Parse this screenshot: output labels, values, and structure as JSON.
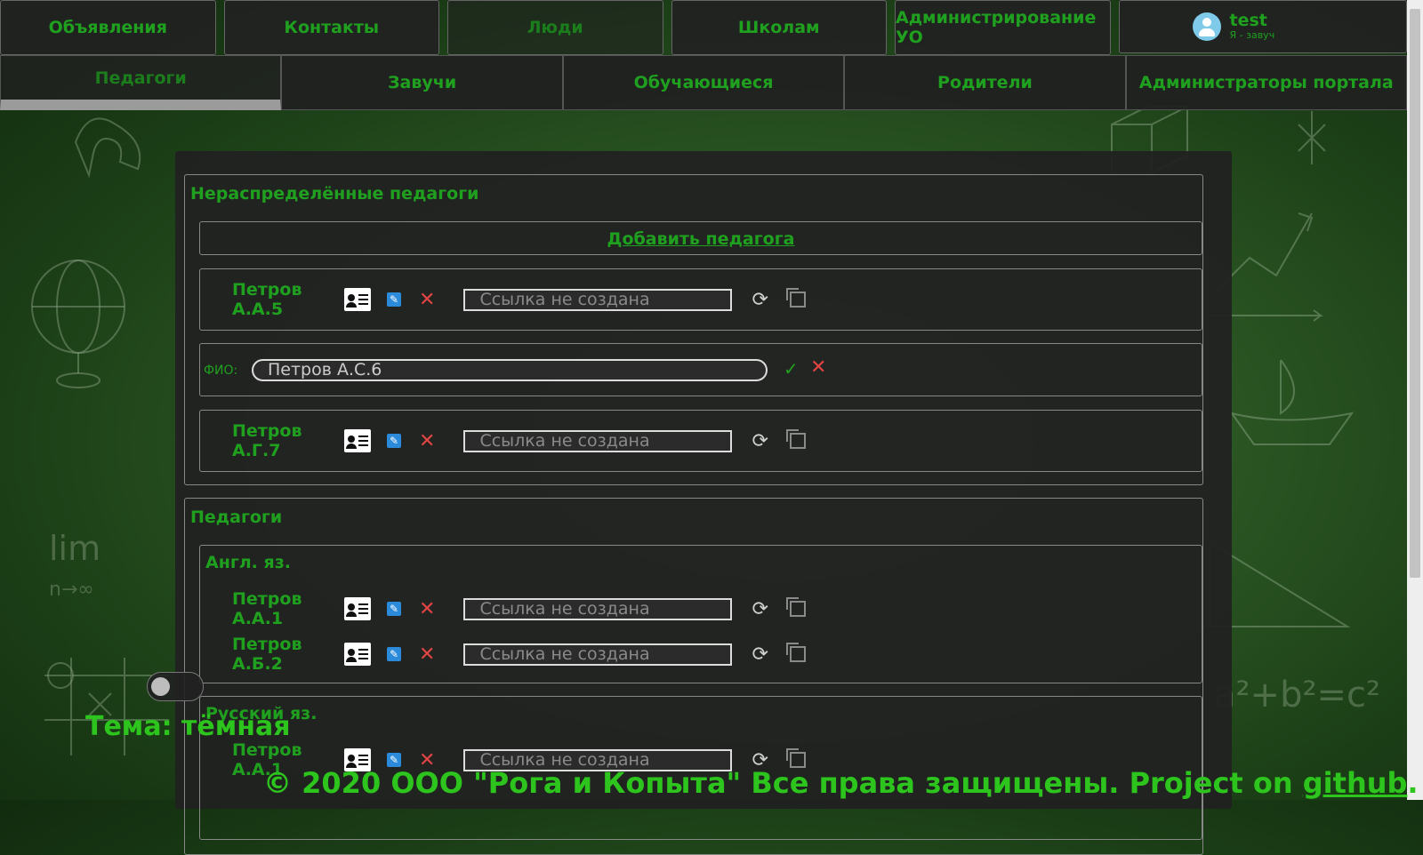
{
  "topnav": {
    "items": [
      {
        "label": "Объявления",
        "active": false
      },
      {
        "label": "Контакты",
        "active": false
      },
      {
        "label": "Люди",
        "active": true
      },
      {
        "label": "Школам",
        "active": false
      },
      {
        "label": "Администрирование УО",
        "active": false
      }
    ],
    "user": {
      "name": "test",
      "role": "Я - завуч"
    }
  },
  "subnav": {
    "items": [
      {
        "label": "Педагоги",
        "active": true
      },
      {
        "label": "Завучи",
        "active": false
      },
      {
        "label": "Обучающиеся",
        "active": false
      },
      {
        "label": "Родители",
        "active": false
      },
      {
        "label": "Администраторы портала",
        "active": false
      }
    ]
  },
  "unassigned": {
    "title": "Нераспределённые педагоги",
    "add_link": "Добавить педагога",
    "teachers": [
      {
        "name": "Петров А.А.5",
        "link_placeholder": "Ссылка не создана"
      }
    ],
    "edit_form": {
      "label": "ФИО:",
      "value": "Петров А.С.6"
    },
    "teachers_after": [
      {
        "name": "Петров А.Г.7",
        "link_placeholder": "Ссылка не создана"
      }
    ]
  },
  "teachers_section": {
    "title": "Педагоги",
    "subjects": [
      {
        "name": "Англ. яз.",
        "teachers": [
          {
            "name": "Петров А.А.1",
            "link_placeholder": "Ссылка не создана"
          },
          {
            "name": "Петров А.Б.2",
            "link_placeholder": "Ссылка не создана"
          }
        ]
      },
      {
        "name": "Русский яз.",
        "teachers": [
          {
            "name": "Петров А.А.1",
            "link_placeholder": "Ссылка не создана"
          }
        ]
      }
    ]
  },
  "theme": {
    "label": "Тема: тёмная"
  },
  "footer": {
    "text": "© 2020 ООО \"Рога и Копыта\" Все права защищены. Project on ",
    "link": "github",
    "end": "."
  },
  "colors": {
    "accent": "#1fa11f",
    "panel": "#212121",
    "danger": "#e24444"
  }
}
